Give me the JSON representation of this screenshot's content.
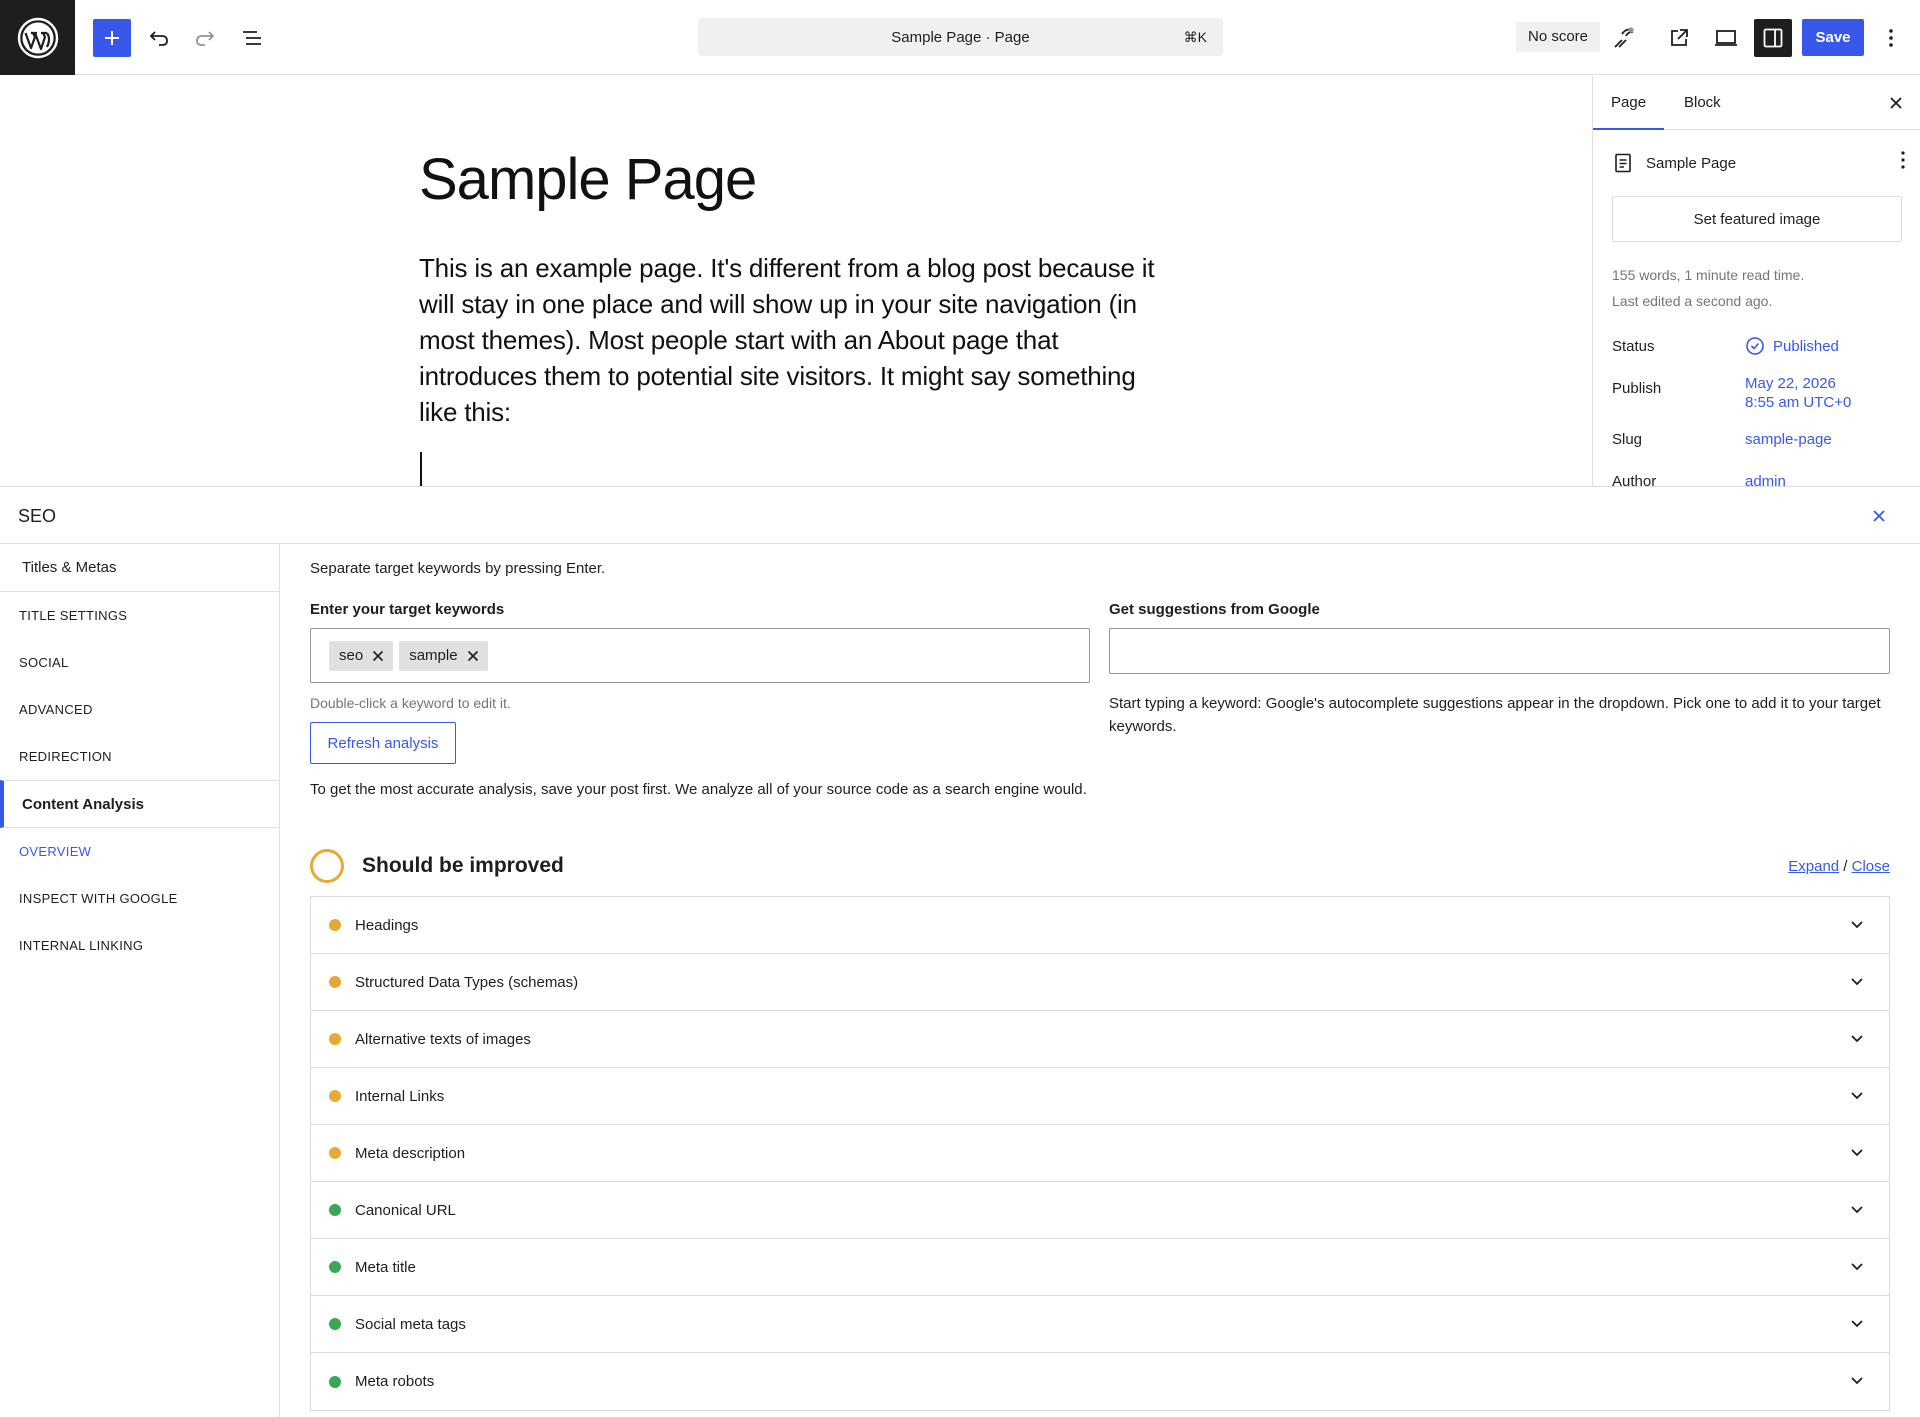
{
  "toolbar": {
    "command_bar_text": "Sample Page · Page",
    "command_shortcut": "⌘K",
    "score_badge": "No score",
    "save_label": "Save"
  },
  "editor": {
    "title": "Sample Page",
    "body": "This is an example page. It's different from a blog post because it will stay in one place and will show up in your site navigation (in most themes). Most people start with an About page that introduces them to potential site visitors. It might say something like this:"
  },
  "sidebar": {
    "tabs": [
      "Page",
      "Block"
    ],
    "doc_title": "Sample Page",
    "featured_image_label": "Set featured image",
    "stats_words": "155 words, 1 minute read time.",
    "stats_edited": "Last edited a second ago.",
    "fields": [
      {
        "label": "Status",
        "value": "Published"
      },
      {
        "label": "Publish",
        "value": "May 22, 2026",
        "value2": "8:55 am UTC+0"
      },
      {
        "label": "Slug",
        "value": "sample-page"
      },
      {
        "label": "Author",
        "value": "admin"
      }
    ]
  },
  "seo": {
    "title": "SEO",
    "nav": {
      "group1": "Titles & Metas",
      "group1_items": [
        "TITLE SETTINGS",
        "SOCIAL",
        "ADVANCED",
        "REDIRECTION"
      ],
      "group2": "Content Analysis",
      "group2_items": [
        "OVERVIEW",
        "INSPECT WITH GOOGLE",
        "INTERNAL LINKING"
      ]
    },
    "separate_hint": "Separate target keywords by pressing Enter.",
    "keywords_label": "Enter your target keywords",
    "keywords": [
      "seo",
      "sample"
    ],
    "keywords_hint": "Double-click a keyword to edit it.",
    "refresh_label": "Refresh analysis",
    "accuracy_note": "To get the most accurate analysis, save your post first. We analyze all of your source code as a search engine would.",
    "google_label": "Get suggestions from Google",
    "google_value": "",
    "google_note": "Start typing a keyword: Google's autocomplete suggestions appear in the dropdown. Pick one to add it to your target keywords.",
    "score_title": "Should be improved",
    "expand_label": "Expand",
    "expand_sep": " / ",
    "close_label": "Close",
    "checks": [
      {
        "label": "Headings",
        "status": "warn"
      },
      {
        "label": "Structured Data Types (schemas)",
        "status": "warn"
      },
      {
        "label": "Alternative texts of images",
        "status": "warn"
      },
      {
        "label": "Internal Links",
        "status": "warn"
      },
      {
        "label": "Meta description",
        "status": "warn"
      },
      {
        "label": "Canonical URL",
        "status": "good"
      },
      {
        "label": "Meta title",
        "status": "good"
      },
      {
        "label": "Social meta tags",
        "status": "good"
      },
      {
        "label": "Meta robots",
        "status": "good"
      }
    ]
  },
  "colors": {
    "accent": "#3858e9",
    "warn": "#e5a935",
    "good": "#38a854",
    "dark": "#1e1e1e"
  }
}
